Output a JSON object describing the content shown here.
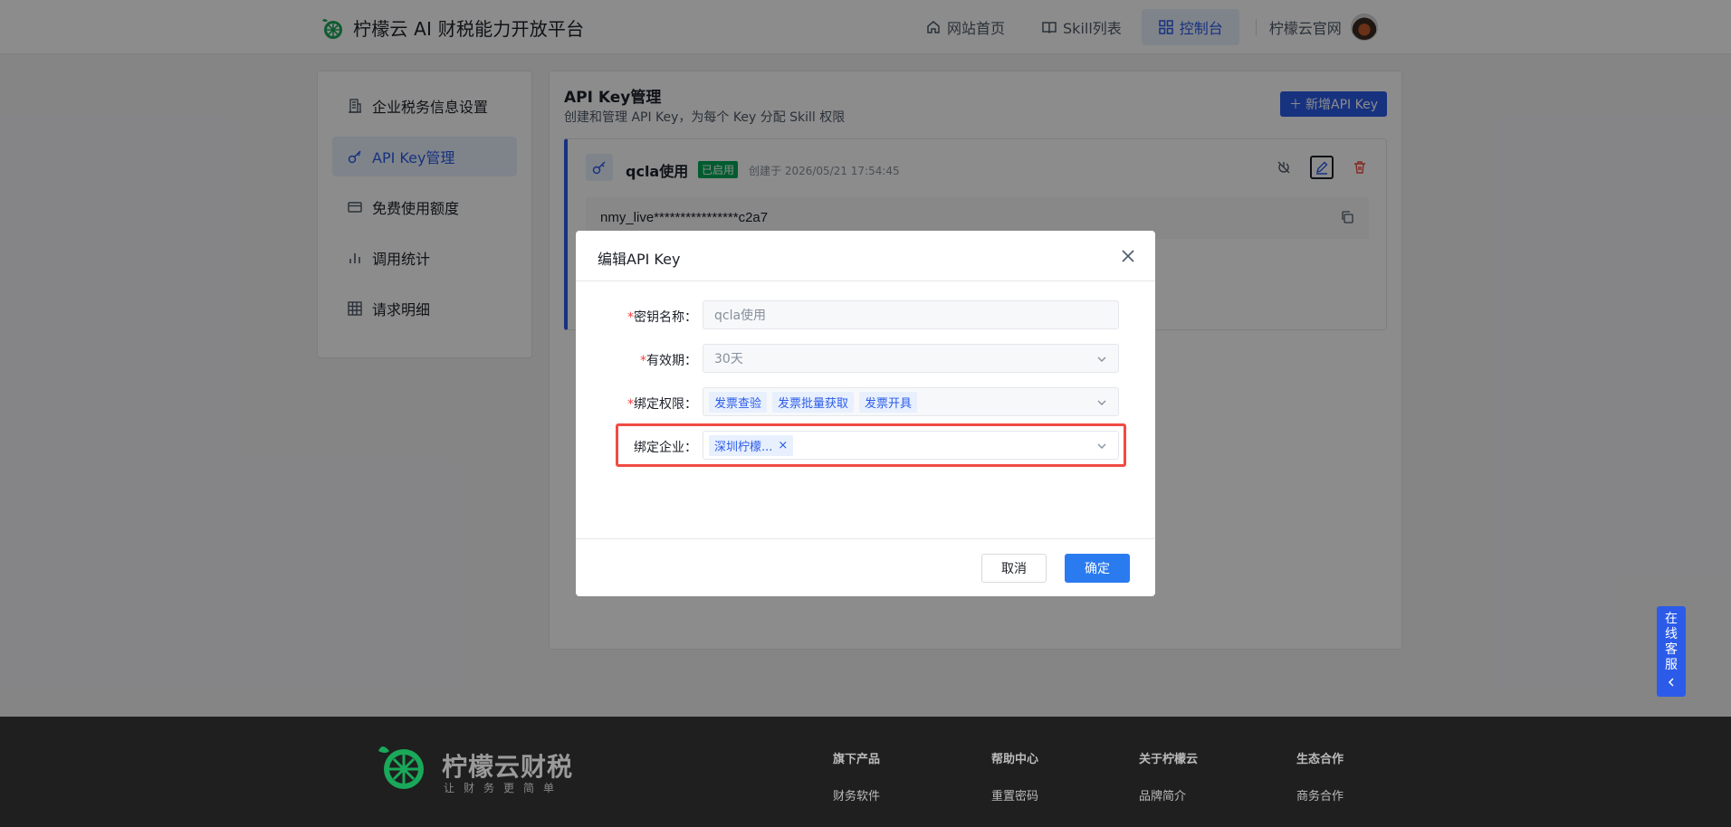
{
  "header": {
    "brand": "柠檬云 AI 财税能力开放平台",
    "nav": [
      {
        "label": "网站首页",
        "icon": "home-icon",
        "active": false
      },
      {
        "label": "Skill列表",
        "icon": "book-icon",
        "active": false
      },
      {
        "label": "控制台",
        "icon": "grid-icon",
        "active": true
      }
    ],
    "official_site": "柠檬云官网"
  },
  "sidebar": {
    "items": [
      {
        "label": "企业税务信息设置",
        "icon": "building-icon"
      },
      {
        "label": "API Key管理",
        "icon": "key-icon",
        "active": true
      },
      {
        "label": "免费使用额度",
        "icon": "card-icon"
      },
      {
        "label": "调用统计",
        "icon": "bar-chart-icon"
      },
      {
        "label": "请求明细",
        "icon": "table-icon"
      }
    ]
  },
  "main": {
    "title": "API Key管理",
    "subtitle": "创建和管理 API Key，为每个 Key 分配 Skill 权限",
    "add_button": "新增API Key",
    "key_card": {
      "name": "qcla使用",
      "status": "已启用",
      "created": "创建于 2026/05/21 17:54:45",
      "secret": "nmy_live****************c2a7"
    }
  },
  "modal": {
    "title": "编辑API Key",
    "fields": {
      "name": {
        "label": "密钥名称：",
        "value": "qcla使用",
        "required": true
      },
      "expiry": {
        "label": "有效期：",
        "value": "30天",
        "required": true
      },
      "permissions": {
        "label": "绑定权限：",
        "tags": [
          "发票查验",
          "发票批量获取",
          "发票开具"
        ],
        "required": true
      },
      "company": {
        "label": "绑定企业：",
        "tags": [
          "深圳柠檬..."
        ],
        "required": false
      }
    },
    "cancel": "取消",
    "confirm": "确定"
  },
  "support": {
    "chars": [
      "在",
      "线",
      "客",
      "服"
    ]
  },
  "footer": {
    "logo": "柠檬云财税",
    "slogan": "让财务更简单",
    "columns": [
      {
        "title": "旗下产品",
        "link": "财务软件"
      },
      {
        "title": "帮助中心",
        "link": "重置密码"
      },
      {
        "title": "关于柠檬云",
        "link": "品牌简介"
      },
      {
        "title": "生态合作",
        "link": "商务合作"
      }
    ]
  },
  "colors": {
    "accent": "#2b5be8",
    "success": "#00a854",
    "danger": "#f04b43"
  }
}
